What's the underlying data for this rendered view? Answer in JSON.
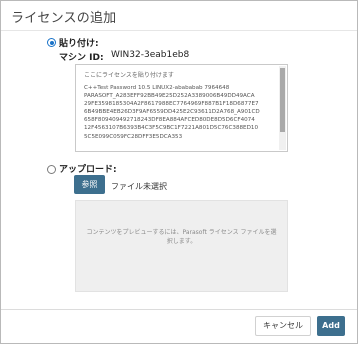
{
  "dialog": {
    "title": "ライセンスの追加"
  },
  "paste_option": {
    "label": "貼り付け:",
    "selected": true,
    "machine_id_label": "マシン ID:",
    "machine_id_value": "WIN32-3eab1eb8",
    "textarea_placeholder": "ここにライセンスを貼り付けます",
    "license_text": "C++Test Password 10.5 LINUX2-abababab 7964648\nPARASOFT_A283EFF92BB49E25D252A3389006B49DD49ACA\n29FE3598185304A2F8617988EC7764969F887B1F18D6877E7\n6B49BBE4EB26D3F9AF6559DD425E2C93611D2A768_A901CD\n658F809409492718243DF8EA884AFCED80DE8D5D6CF4074\n12F4563107B6393B4C3F5C9BC1F7221A801D5C76C388ED10\n5C5E099C059FC28DFF3E5DCA353"
  },
  "upload_option": {
    "label": "アップロード:",
    "selected": false,
    "browse_label": "参照",
    "file_status": "ファイル未選択",
    "preview_text": "コンテンツをプレビューするには、Parasoft ライセンス ファイルを選択します。"
  },
  "footer": {
    "cancel_label": "キャンセル",
    "add_label": "Add"
  },
  "colors": {
    "primary": "#3d6f8e",
    "radio_selected": "#1a73c8",
    "preview_bg": "#efefef"
  }
}
